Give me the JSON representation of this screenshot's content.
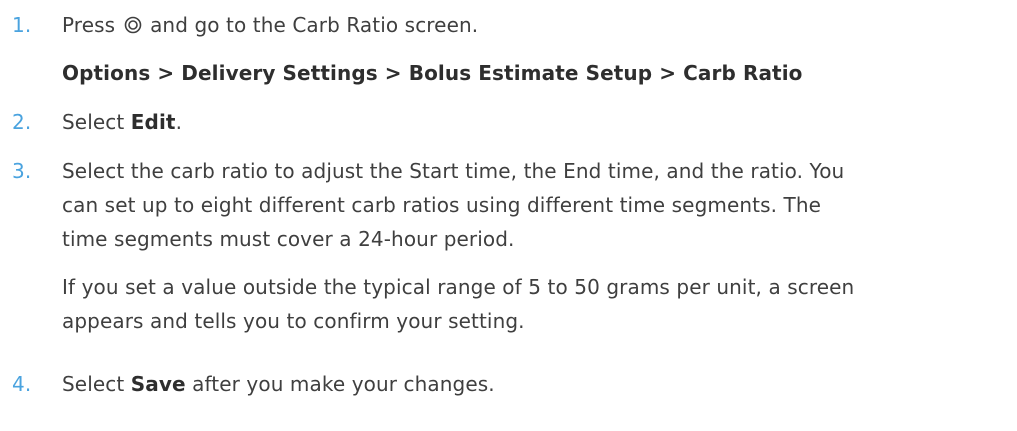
{
  "steps": [
    {
      "number": "1.",
      "prefix": "Press",
      "icon": "select-button-icon",
      "suffix": "and go to the Carb Ratio screen.",
      "path": "Options > Delivery Settings > Bolus Estimate Setup > Carb Ratio"
    },
    {
      "number": "2.",
      "prefix": "Select",
      "bold": "Edit",
      "suffix": "."
    },
    {
      "number": "3.",
      "lines": [
        "Select the carb ratio to adjust the Start time, the End time, and the ratio. You",
        "can set up to eight different carb ratios using different time segments. The",
        "time segments must cover a 24-hour period."
      ],
      "note_lines": [
        "If you set a value outside the typical range of 5 to 50 grams per unit, a screen",
        "appears and tells you to confirm your setting."
      ]
    },
    {
      "number": "4.",
      "prefix": "Select",
      "bold": "Save",
      "suffix": "after you make your changes."
    }
  ],
  "colors": {
    "number": "#4aa3df",
    "text": "#3f3f3f"
  }
}
